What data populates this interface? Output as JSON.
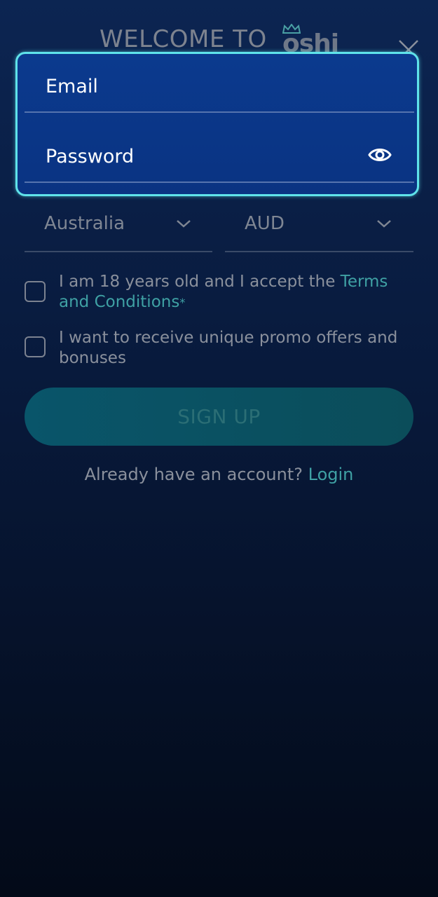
{
  "header": {
    "welcome_text": "WELCOME TO",
    "logo_text": "oshi"
  },
  "form": {
    "email_placeholder": "Email",
    "password_placeholder": "Password",
    "country_value": "Australia",
    "currency_value": "AUD",
    "age_terms_prefix": "I am 18 years old and I accept the ",
    "terms_link": "Terms and Conditions",
    "terms_asterisk": "*",
    "promo_text": "I want to receive unique promo offers and bonuses",
    "signup_label": "SIGN UP",
    "already_account_text": "Already have an account? ",
    "login_link": "Login"
  },
  "colors": {
    "highlight_border": "#5fe3ea",
    "accent_link": "#3fa1a4",
    "background_top": "#0c2552",
    "background_bottom": "#030a18"
  },
  "icons": {
    "close": "close-icon",
    "eye": "eye-icon",
    "chevron": "chevron-down-icon",
    "crown": "crown-icon"
  }
}
